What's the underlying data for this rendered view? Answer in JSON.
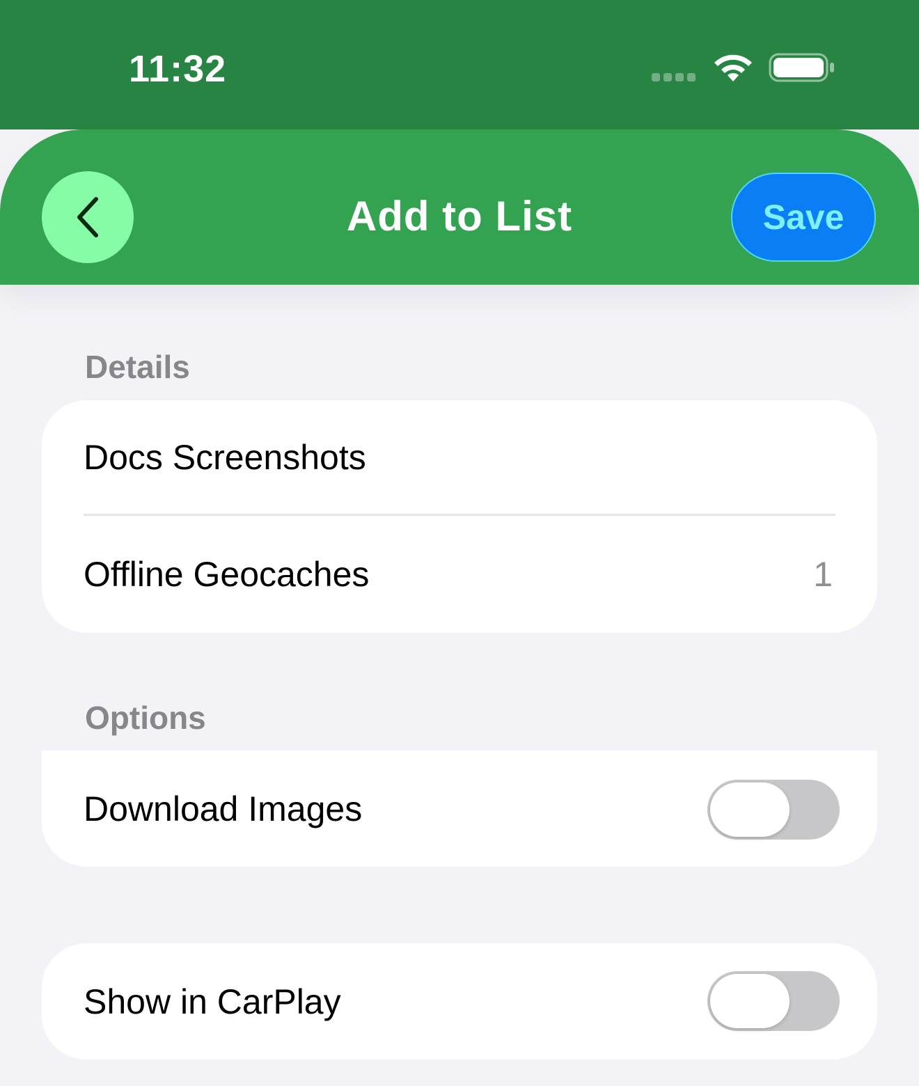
{
  "status_bar": {
    "time": "11:32",
    "icons": [
      "signal-dots-icon",
      "wifi-icon",
      "battery-icon"
    ]
  },
  "nav": {
    "back_icon": "chevron-left-icon",
    "title": "Add to List",
    "save_label": "Save"
  },
  "sections": {
    "details": {
      "header": "Details",
      "rows": [
        {
          "label": "Docs Screenshots",
          "value": ""
        },
        {
          "label": "Offline Geocaches",
          "value": "1"
        }
      ]
    },
    "options": {
      "header": "Options",
      "download_images": {
        "label": "Download Images",
        "enabled": false
      }
    },
    "carplay": {
      "show_in_carplay": {
        "label": "Show in CarPlay",
        "enabled": false
      }
    }
  },
  "colors": {
    "status_bar_bg": "#288443",
    "header_bg": "#33a352",
    "back_button_bg": "#87fca6",
    "save_button_bg": "#0a7ef4",
    "save_button_text": "#7df0ff",
    "page_bg": "#f2f2f7",
    "toggle_off": "#c7c7c9"
  }
}
